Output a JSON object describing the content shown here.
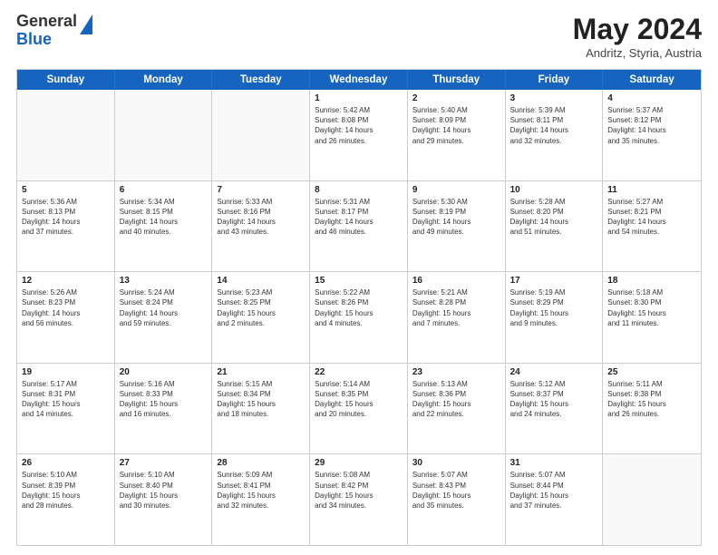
{
  "header": {
    "logo_general": "General",
    "logo_blue": "Blue",
    "month_year": "May 2024",
    "location": "Andritz, Styria, Austria"
  },
  "weekdays": [
    "Sunday",
    "Monday",
    "Tuesday",
    "Wednesday",
    "Thursday",
    "Friday",
    "Saturday"
  ],
  "rows": [
    [
      {
        "day": "",
        "info": ""
      },
      {
        "day": "",
        "info": ""
      },
      {
        "day": "",
        "info": ""
      },
      {
        "day": "1",
        "info": "Sunrise: 5:42 AM\nSunset: 8:08 PM\nDaylight: 14 hours\nand 26 minutes."
      },
      {
        "day": "2",
        "info": "Sunrise: 5:40 AM\nSunset: 8:09 PM\nDaylight: 14 hours\nand 29 minutes."
      },
      {
        "day": "3",
        "info": "Sunrise: 5:39 AM\nSunset: 8:11 PM\nDaylight: 14 hours\nand 32 minutes."
      },
      {
        "day": "4",
        "info": "Sunrise: 5:37 AM\nSunset: 8:12 PM\nDaylight: 14 hours\nand 35 minutes."
      }
    ],
    [
      {
        "day": "5",
        "info": "Sunrise: 5:36 AM\nSunset: 8:13 PM\nDaylight: 14 hours\nand 37 minutes."
      },
      {
        "day": "6",
        "info": "Sunrise: 5:34 AM\nSunset: 8:15 PM\nDaylight: 14 hours\nand 40 minutes."
      },
      {
        "day": "7",
        "info": "Sunrise: 5:33 AM\nSunset: 8:16 PM\nDaylight: 14 hours\nand 43 minutes."
      },
      {
        "day": "8",
        "info": "Sunrise: 5:31 AM\nSunset: 8:17 PM\nDaylight: 14 hours\nand 46 minutes."
      },
      {
        "day": "9",
        "info": "Sunrise: 5:30 AM\nSunset: 8:19 PM\nDaylight: 14 hours\nand 49 minutes."
      },
      {
        "day": "10",
        "info": "Sunrise: 5:28 AM\nSunset: 8:20 PM\nDaylight: 14 hours\nand 51 minutes."
      },
      {
        "day": "11",
        "info": "Sunrise: 5:27 AM\nSunset: 8:21 PM\nDaylight: 14 hours\nand 54 minutes."
      }
    ],
    [
      {
        "day": "12",
        "info": "Sunrise: 5:26 AM\nSunset: 8:23 PM\nDaylight: 14 hours\nand 56 minutes."
      },
      {
        "day": "13",
        "info": "Sunrise: 5:24 AM\nSunset: 8:24 PM\nDaylight: 14 hours\nand 59 minutes."
      },
      {
        "day": "14",
        "info": "Sunrise: 5:23 AM\nSunset: 8:25 PM\nDaylight: 15 hours\nand 2 minutes."
      },
      {
        "day": "15",
        "info": "Sunrise: 5:22 AM\nSunset: 8:26 PM\nDaylight: 15 hours\nand 4 minutes."
      },
      {
        "day": "16",
        "info": "Sunrise: 5:21 AM\nSunset: 8:28 PM\nDaylight: 15 hours\nand 7 minutes."
      },
      {
        "day": "17",
        "info": "Sunrise: 5:19 AM\nSunset: 8:29 PM\nDaylight: 15 hours\nand 9 minutes."
      },
      {
        "day": "18",
        "info": "Sunrise: 5:18 AM\nSunset: 8:30 PM\nDaylight: 15 hours\nand 11 minutes."
      }
    ],
    [
      {
        "day": "19",
        "info": "Sunrise: 5:17 AM\nSunset: 8:31 PM\nDaylight: 15 hours\nand 14 minutes."
      },
      {
        "day": "20",
        "info": "Sunrise: 5:16 AM\nSunset: 8:33 PM\nDaylight: 15 hours\nand 16 minutes."
      },
      {
        "day": "21",
        "info": "Sunrise: 5:15 AM\nSunset: 8:34 PM\nDaylight: 15 hours\nand 18 minutes."
      },
      {
        "day": "22",
        "info": "Sunrise: 5:14 AM\nSunset: 8:35 PM\nDaylight: 15 hours\nand 20 minutes."
      },
      {
        "day": "23",
        "info": "Sunrise: 5:13 AM\nSunset: 8:36 PM\nDaylight: 15 hours\nand 22 minutes."
      },
      {
        "day": "24",
        "info": "Sunrise: 5:12 AM\nSunset: 8:37 PM\nDaylight: 15 hours\nand 24 minutes."
      },
      {
        "day": "25",
        "info": "Sunrise: 5:11 AM\nSunset: 8:38 PM\nDaylight: 15 hours\nand 26 minutes."
      }
    ],
    [
      {
        "day": "26",
        "info": "Sunrise: 5:10 AM\nSunset: 8:39 PM\nDaylight: 15 hours\nand 28 minutes."
      },
      {
        "day": "27",
        "info": "Sunrise: 5:10 AM\nSunset: 8:40 PM\nDaylight: 15 hours\nand 30 minutes."
      },
      {
        "day": "28",
        "info": "Sunrise: 5:09 AM\nSunset: 8:41 PM\nDaylight: 15 hours\nand 32 minutes."
      },
      {
        "day": "29",
        "info": "Sunrise: 5:08 AM\nSunset: 8:42 PM\nDaylight: 15 hours\nand 34 minutes."
      },
      {
        "day": "30",
        "info": "Sunrise: 5:07 AM\nSunset: 8:43 PM\nDaylight: 15 hours\nand 35 minutes."
      },
      {
        "day": "31",
        "info": "Sunrise: 5:07 AM\nSunset: 8:44 PM\nDaylight: 15 hours\nand 37 minutes."
      },
      {
        "day": "",
        "info": ""
      }
    ]
  ]
}
